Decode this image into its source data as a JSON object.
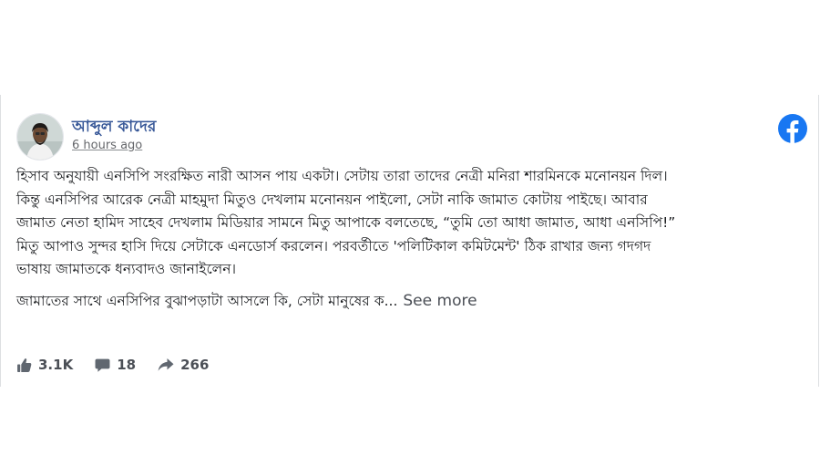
{
  "post": {
    "author_name": "আব্দুল কাদের",
    "timestamp": "6 hours ago",
    "paragraph_lines": [
      "হিসাব অনুযায়ী এনসিপি সংরক্ষিত নারী আসন পায় একটা। সেটায় তারা তাদের নেত্রী মনিরা শারমিনকে মনোনয়ন দিল।",
      "কিন্তু এনসিপির আরেক নেত্রী মাহমুদা মিতুও দেখলাম মনোনয়ন পাইলো, সেটা নাকি জামাত কোটায় পাইছে। আবার",
      "জামাত নেতা হামিদ সাহেব দেখলাম মিডিয়ার সামনে মিতু আপাকে বলতেছে, “তুমি তো আধা জামাত, আধা এনসিপি!”",
      "মিতু আপাও সুন্দর হাসি দিয়ে সেটাকে এনডোর্স করলেন। পরবর্তীতে 'পলিটিকাল কমিটমেন্ট' ঠিক রাখার জন্য গদগদ",
      "ভাষায় জামাতকে ধন্যবাদও জানাইলেন।"
    ],
    "truncated_line": "জামাতের সাথে এনসিপির বুঝাপড়াটা আসলে কি, সেটা মানুষের ক...",
    "see_more_label": "See more"
  },
  "stats": {
    "likes": "3.1K",
    "comments": "18",
    "shares": "266"
  },
  "icons": {
    "platform": "facebook-icon",
    "like": "thumbs-up-icon",
    "comment": "comment-bubble-icon",
    "share": "share-arrow-icon"
  },
  "colors": {
    "author": "#385898",
    "facebook_blue": "#1877f2",
    "meta_gray": "#65676b",
    "stats_gray": "#4b4f56"
  }
}
